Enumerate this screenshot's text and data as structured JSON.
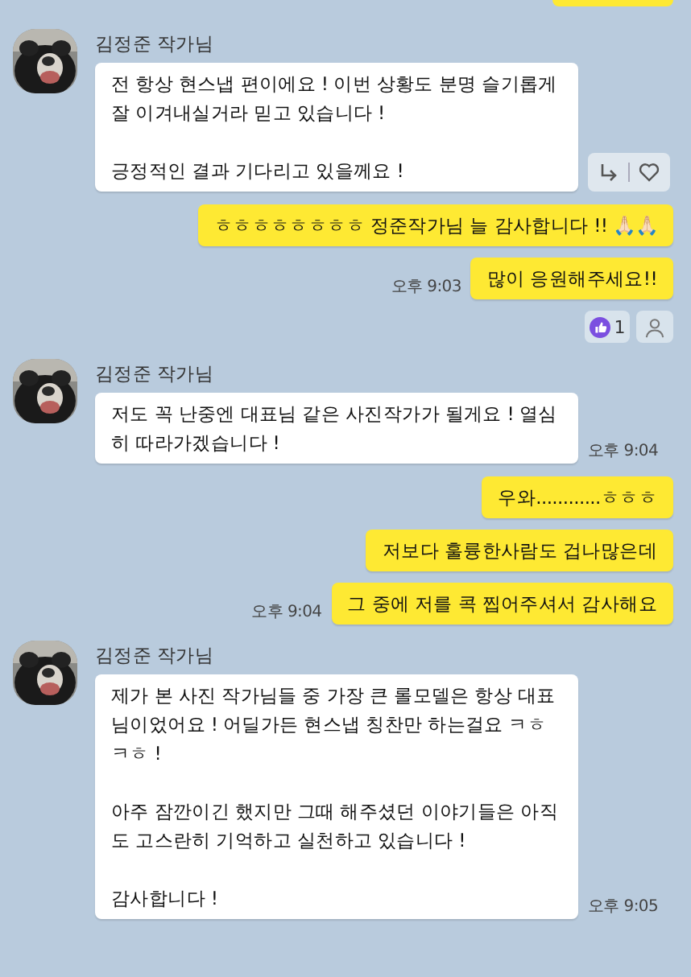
{
  "messages": [
    {
      "kind": "clipped"
    },
    {
      "kind": "incoming",
      "sender": "김정준 작가님",
      "bubbles": [
        "전 항상 현스냅 편이에요 ! 이번 상황도 분명 슬기롭게 잘 이겨내실거라 믿고 있습니다 !\n\n긍정적인 결과 기다리고 있을께요 !"
      ],
      "actions": true
    },
    {
      "kind": "outgoing",
      "bubbles": [
        "ㅎㅎㅎㅎㅎㅎㅎㅎ 정준작가님 늘 감사합니다 !! 🙏🏻🙏🏻",
        "많이 응원해주세요!!"
      ],
      "time": "오후 9:03",
      "reactions": {
        "like_count": "1"
      }
    },
    {
      "kind": "incoming",
      "sender": "김정준 작가님",
      "bubbles": [
        "저도 꼭 난중엔 대표님 같은 사진작가가 될게요 ! 열심히 따라가겠습니다 !"
      ],
      "time": "오후 9:04"
    },
    {
      "kind": "outgoing",
      "bubbles": [
        "우와............ㅎㅎㅎ",
        "저보다 훌륭한사람도 겁나많은데",
        "그 중에 저를 콕 찝어주셔서 감사해요"
      ],
      "time": "오후 9:04"
    },
    {
      "kind": "incoming",
      "sender": "김정준 작가님",
      "bubbles": [
        "제가 본 사진 작가님들 중 가장 큰 롤모델은 항상 대표님이었어요 ! 어딜가든 현스냅 칭찬만 하는걸요 ㅋㅎㅋㅎ !\n\n아주 잠깐이긴 했지만 그때 해주셨던 이야기들은 아직도 고스란히 기억하고 실천하고 있습니다 !\n\n감사합니다 !"
      ],
      "time": "오후 9:05"
    }
  ]
}
